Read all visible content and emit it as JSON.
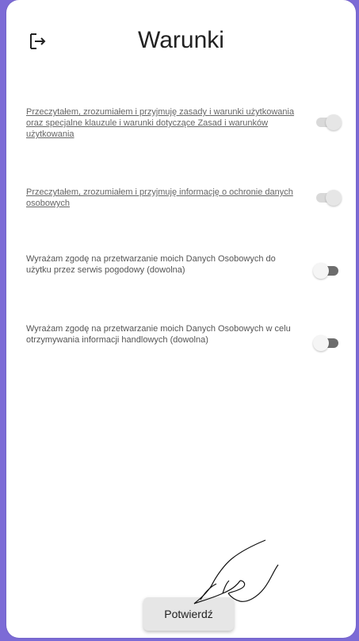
{
  "header": {
    "title": "Warunki",
    "logout_icon": "logout-icon"
  },
  "consents": [
    {
      "text": "Przeczytałem, zrozumiałem i przyjmuję zasady i warunki użytkowania oraz specjalne klauzule i warunki dotyczące Zasad i warunków użytkowania",
      "enabled": true,
      "disabled": true
    },
    {
      "text": "Przeczytałem, zrozumiałem i przyjmuję informację o ochronie danych osobowych",
      "enabled": true,
      "disabled": true
    },
    {
      "text": "Wyrażam zgodę na przetwarzanie moich Danych Osobowych do użytku przez serwis pogodowy (dowolna)",
      "enabled": false,
      "disabled": false
    },
    {
      "text": "Wyrażam zgodę na przetwarzanie moich Danych Osobowych w celu otrzymywania informacji handlowych (dowolna)",
      "enabled": false,
      "disabled": false
    }
  ],
  "footer": {
    "confirm_label": "Potwierdź"
  },
  "colors": {
    "accent": "#7c6bd6",
    "background": "#ffffff",
    "button": "#e6e6e6",
    "toggle_off_track": "#6d6d6d",
    "toggle_on_track": "#d9d9d9"
  }
}
